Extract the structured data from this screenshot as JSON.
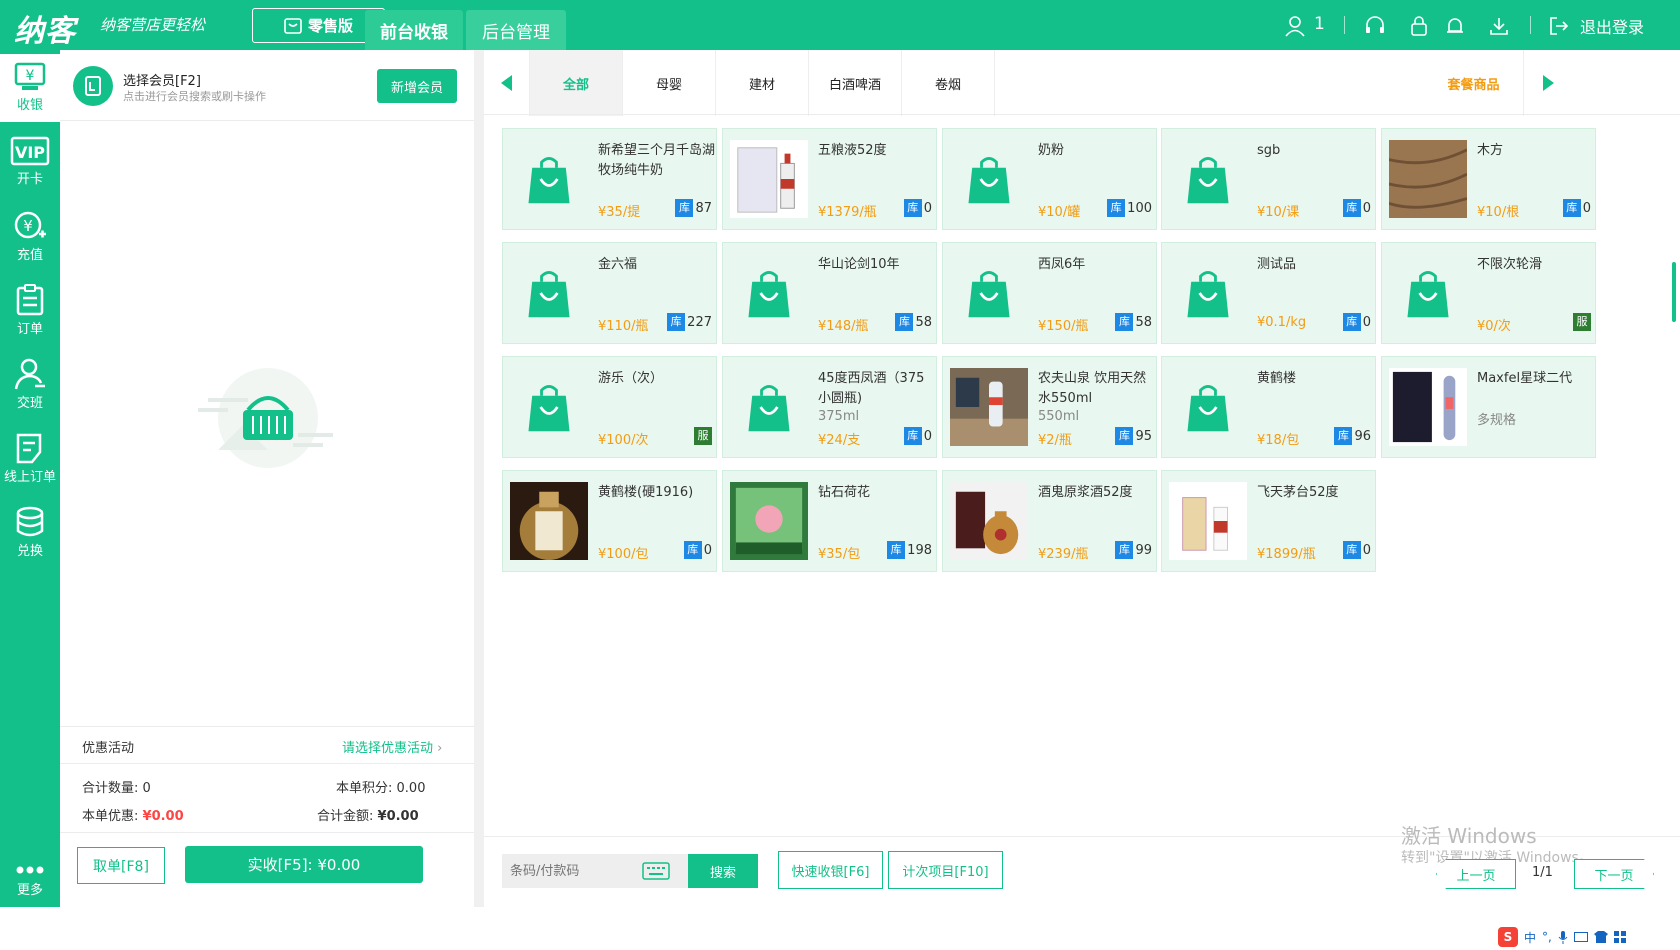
{
  "header": {
    "logo": "纳客",
    "slogan": "纳客营店更轻松",
    "edition": "零售版",
    "nav": [
      "前台收银",
      "后台管理"
    ],
    "user_count": "1",
    "logout": "退出登录"
  },
  "sidebar": {
    "items": [
      {
        "label": "收银",
        "icon": "cashier-icon"
      },
      {
        "label": "开卡",
        "icon": "vip-card-icon"
      },
      {
        "label": "充值",
        "icon": "recharge-icon"
      },
      {
        "label": "订单",
        "icon": "order-icon"
      },
      {
        "label": "交班",
        "icon": "shift-icon"
      },
      {
        "label": "线上订单",
        "icon": "online-order-icon"
      },
      {
        "label": "兑换",
        "icon": "exchange-icon"
      }
    ],
    "more": "更多"
  },
  "member": {
    "title": "选择会员[F2]",
    "subtitle": "点击进行会员搜索或刷卡操作",
    "add_button": "新增会员"
  },
  "promotion": {
    "label": "优惠活动",
    "select": "请选择优惠活动"
  },
  "totals": {
    "qty_label": "合计数量:",
    "qty": "0",
    "points_label": "本单积分:",
    "points": "0.00",
    "discount_label": "本单优惠:",
    "discount": "¥0.00",
    "amount_label": "合计金额:",
    "amount": "¥0.00"
  },
  "actions": {
    "cancel": "取单[F8]",
    "pay": "实收[F5]: ¥0.00"
  },
  "categories": [
    "全部",
    "母婴",
    "建材",
    "白酒啤酒",
    "卷烟"
  ],
  "package_label": "套餐商品",
  "products": [
    {
      "name": "新希望三个月千岛湖牧场纯牛奶",
      "spec": "",
      "price": "¥35/提",
      "stock": "87",
      "tag": "库",
      "img": "bag"
    },
    {
      "name": "五粮液52度",
      "spec": "",
      "price": "¥1379/瓶",
      "stock": "0",
      "tag": "库",
      "img": "liquor"
    },
    {
      "name": "奶粉",
      "spec": "",
      "price": "¥10/罐",
      "stock": "100",
      "tag": "库",
      "img": "bag"
    },
    {
      "name": "sgb",
      "spec": "",
      "price": "¥10/课",
      "stock": "0",
      "tag": "库",
      "img": "bag"
    },
    {
      "name": "木方",
      "spec": "",
      "price": "¥10/根",
      "stock": "0",
      "tag": "库",
      "img": "wood"
    },
    {
      "name": "金六福",
      "spec": "",
      "price": "¥110/瓶",
      "stock": "227",
      "tag": "库",
      "img": "bag"
    },
    {
      "name": "华山论剑10年",
      "spec": "",
      "price": "¥148/瓶",
      "stock": "58",
      "tag": "库",
      "img": "bag"
    },
    {
      "name": "西凤6年",
      "spec": "",
      "price": "¥150/瓶",
      "stock": "58",
      "tag": "库",
      "img": "bag"
    },
    {
      "name": "测试品",
      "spec": "",
      "price": "¥0.1/kg",
      "stock": "0",
      "tag": "库",
      "img": "bag"
    },
    {
      "name": "不限次轮滑",
      "spec": "",
      "price": "¥0/次",
      "stock": "",
      "tag": "服",
      "img": "bag"
    },
    {
      "name": "游乐（次）",
      "spec": "",
      "price": "¥100/次",
      "stock": "",
      "tag": "服",
      "img": "bag"
    },
    {
      "name": "45度西凤酒（375小圆瓶)",
      "spec": "375ml",
      "price": "¥24/支",
      "stock": "0",
      "tag": "库",
      "img": "bag"
    },
    {
      "name": "农夫山泉 饮用天然水550ml",
      "spec": "550ml",
      "price": "¥2/瓶",
      "stock": "95",
      "tag": "库",
      "img": "water"
    },
    {
      "name": "黄鹤楼",
      "spec": "",
      "price": "¥18/包",
      "stock": "96",
      "tag": "库",
      "img": "bag"
    },
    {
      "name": "Maxfel星球二代",
      "spec": "多规格",
      "price": "",
      "stock": "",
      "tag": "",
      "img": "device"
    },
    {
      "name": "黄鹤楼(硬1916)",
      "spec": "",
      "price": "¥100/包",
      "stock": "0",
      "tag": "库",
      "img": "cig"
    },
    {
      "name": "钻石荷花",
      "spec": "",
      "price": "¥35/包",
      "stock": "198",
      "tag": "库",
      "img": "lotus"
    },
    {
      "name": "酒鬼原浆酒52度",
      "spec": "",
      "price": "¥239/瓶",
      "stock": "99",
      "tag": "库",
      "img": "jar"
    },
    {
      "name": "飞天茅台52度",
      "spec": "",
      "price": "¥1899/瓶",
      "stock": "0",
      "tag": "库",
      "img": "maotai"
    }
  ],
  "search": {
    "placeholder": "条码/付款码",
    "button": "搜索"
  },
  "quick": {
    "fast": "快速收银[F6]",
    "count": "计次项目[F10]"
  },
  "pager": {
    "prev": "上一页",
    "page": "1/1",
    "next": "下一页"
  },
  "watermark": {
    "line1": "激活 Windows",
    "line2": "转到\"设置\"以激活 Windows。"
  },
  "ime": [
    "中",
    "°,"
  ]
}
